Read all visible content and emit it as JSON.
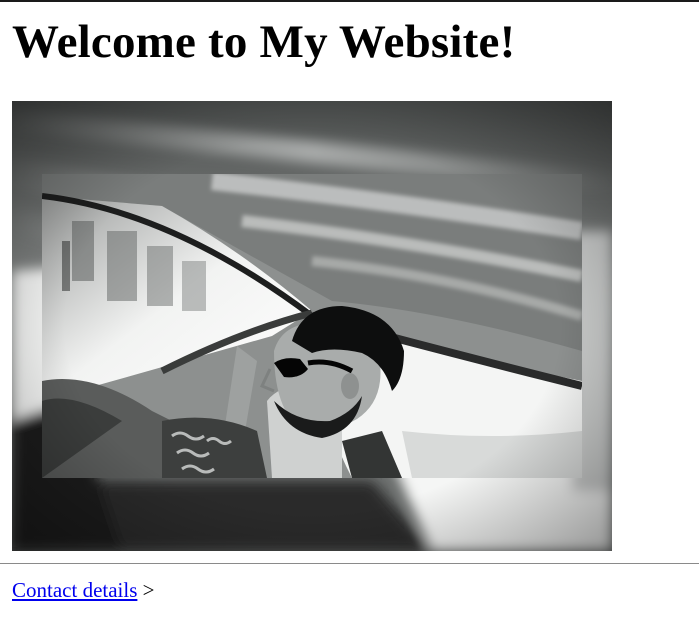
{
  "page": {
    "heading": "Welcome to My Website!"
  },
  "image": {
    "subject": "black-and-white-selfie-in-car",
    "palette": [
      "#f4f5f4",
      "#c9cbca",
      "#7d7f7e",
      "#3a3c3b",
      "#0c0d0d"
    ]
  },
  "footer": {
    "contact_link": "Contact details",
    "contact_suffix": ">",
    "link_color": "#0000ee"
  }
}
